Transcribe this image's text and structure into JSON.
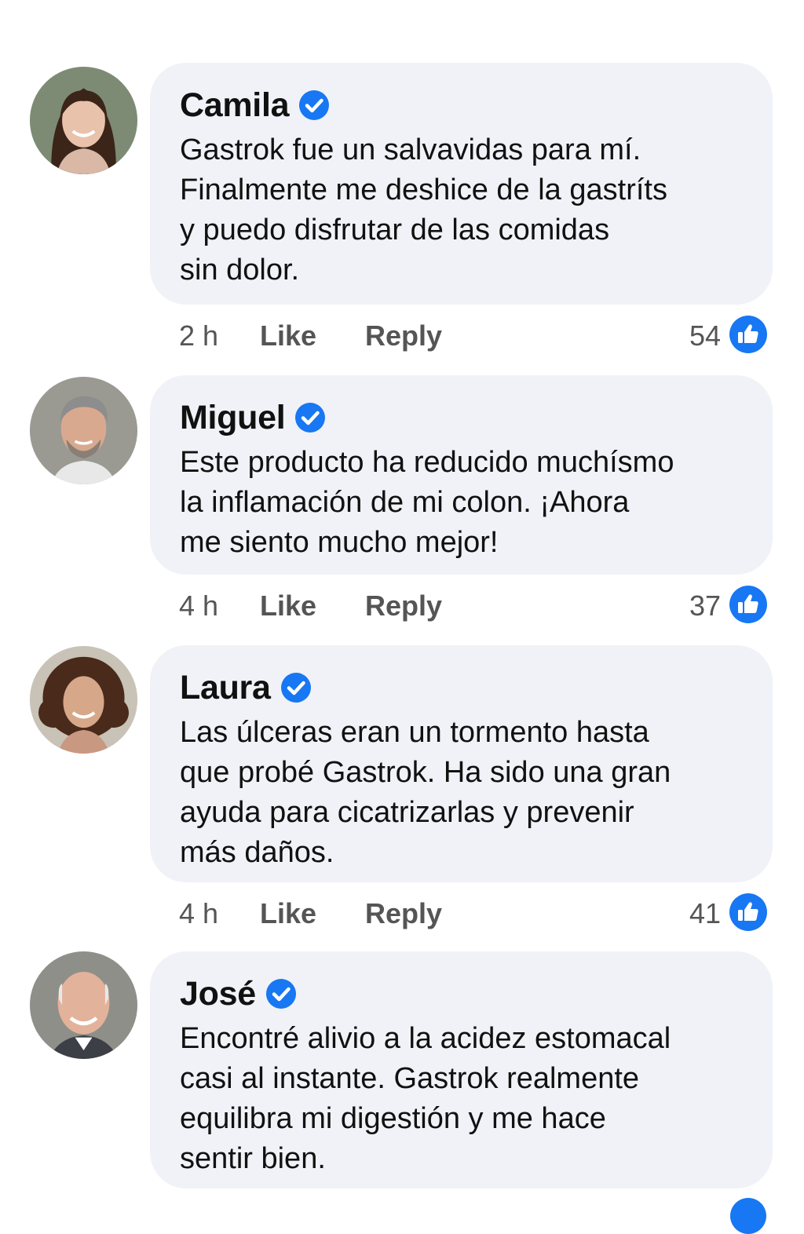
{
  "accent_color": "#1877f2",
  "bubble_color": "#f0f2f7",
  "comments": [
    {
      "name": "Camila",
      "verified": true,
      "lines": [
        "Gastrok fue un salvavidas para mí.",
        "Finalmente me deshice de la gastríts",
        "y puedo disfrutar de las comidas",
        "sin dolor."
      ],
      "time": "2 h",
      "like_label": "Like",
      "reply_label": "Reply",
      "like_count": "54",
      "avatar_icon": "avatar-woman-dark-hair"
    },
    {
      "name": "Miguel",
      "verified": true,
      "lines": [
        "Este producto ha reducido muchísmo",
        "la inflamación de mi colon. ¡Ahora",
        "me siento mucho mejor!"
      ],
      "time": "4 h",
      "like_label": "Like",
      "reply_label": "Reply",
      "like_count": "37",
      "avatar_icon": "avatar-man-gray-hair"
    },
    {
      "name": "Laura",
      "verified": true,
      "lines": [
        "Las úlceras eran un tormento hasta",
        "que probé Gastrok. Ha sido una gran",
        "ayuda para cicatrizarlas y prevenir",
        "más daños."
      ],
      "time": "4 h",
      "like_label": "Like",
      "reply_label": "Reply",
      "like_count": "41",
      "avatar_icon": "avatar-woman-curly-hair"
    },
    {
      "name": "José",
      "verified": true,
      "lines": [
        "Encontré alivio a la acidez estomacal",
        "casi al instante. Gastrok realmente",
        "equilibra mi digestión y me hace",
        "sentir bien."
      ],
      "avatar_icon": "avatar-bald-man"
    }
  ]
}
